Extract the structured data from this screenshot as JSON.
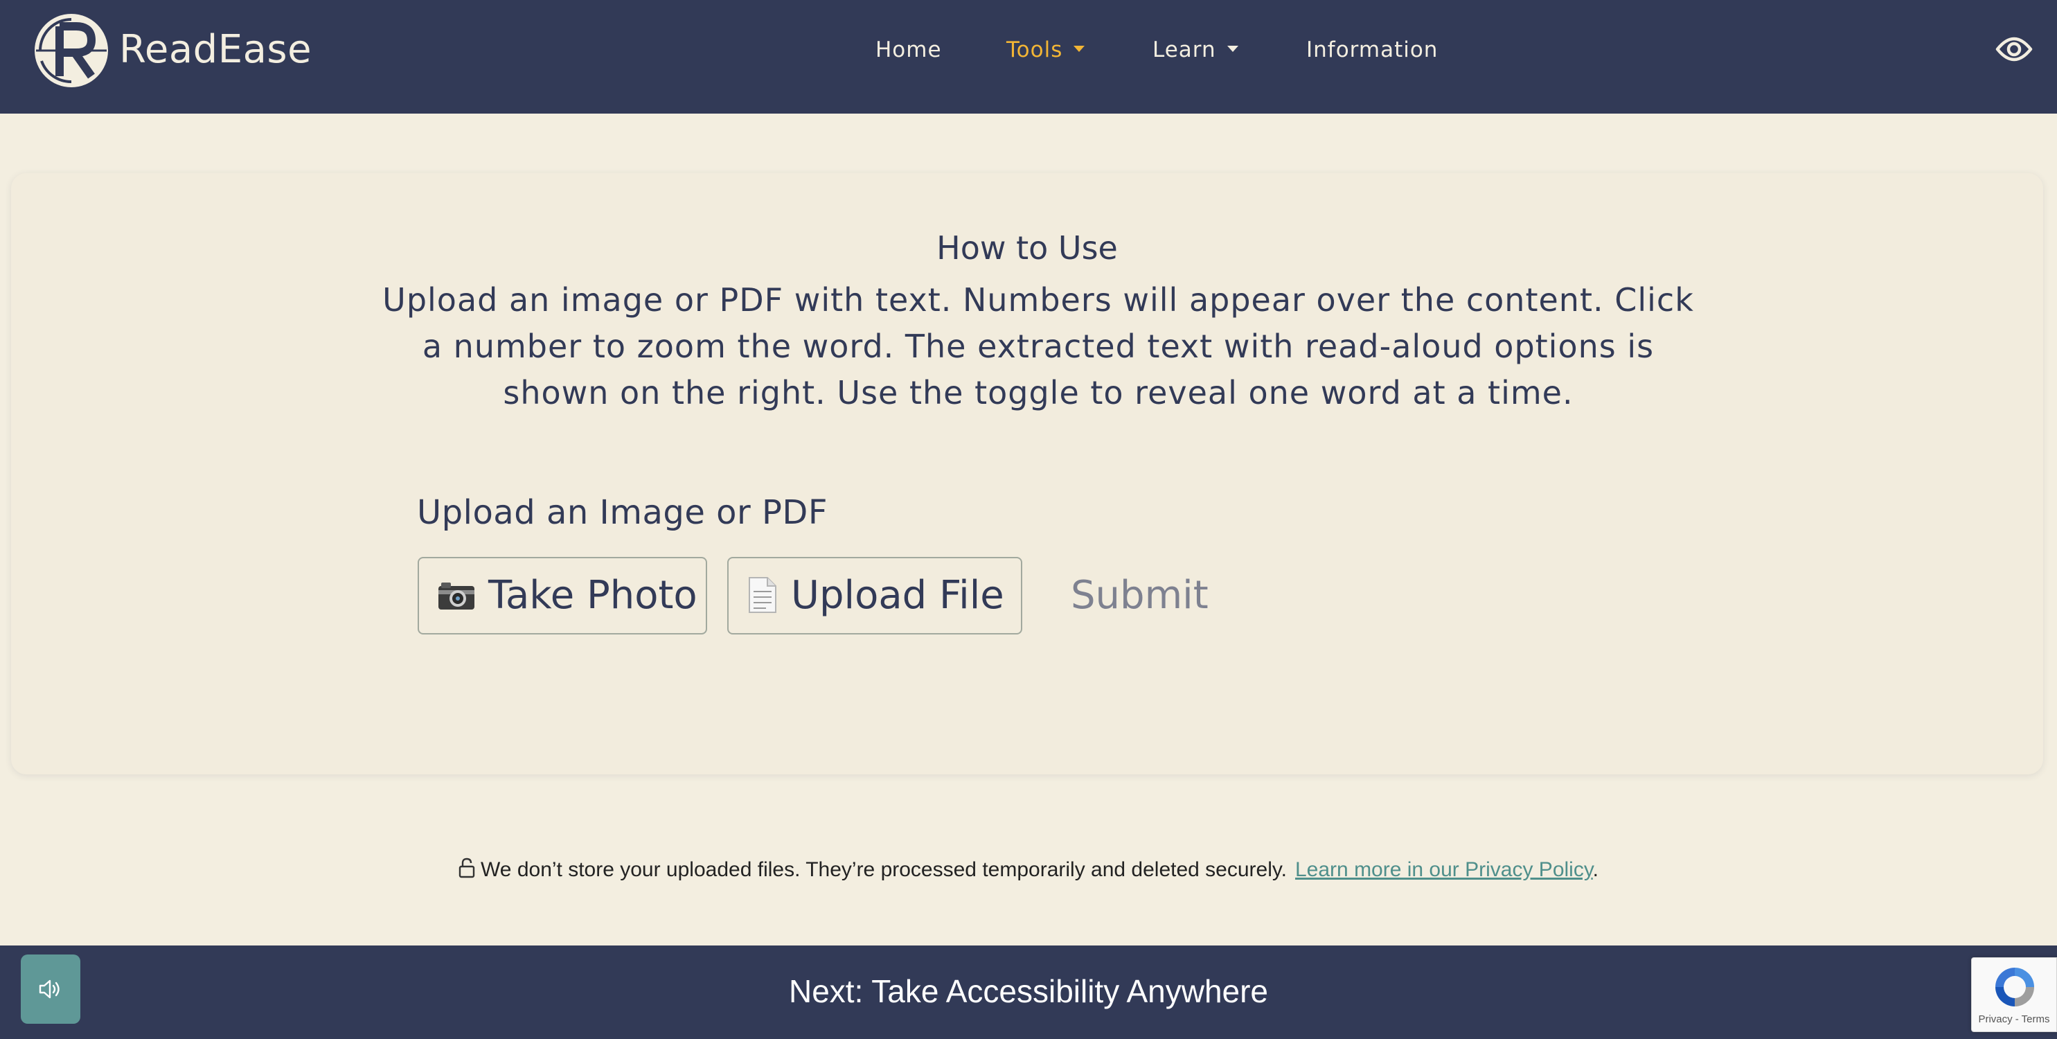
{
  "header": {
    "brand": "ReadEase",
    "nav": {
      "home": "Home",
      "tools": "Tools",
      "learn": "Learn",
      "information": "Information"
    },
    "active_color": "#f2b535",
    "background": "#323a57"
  },
  "card": {
    "title": "How to Use",
    "text": "Upload an image or PDF with text. Numbers will appear over the content. Click a number to zoom the word. The extracted text with read-aloud options is shown on the right. Use the toggle to reveal one word at a time.",
    "upload_label": "Upload an Image or PDF",
    "take_photo": "Take Photo",
    "upload_file": "Upload File",
    "submit": "Submit"
  },
  "privacy": {
    "text": "We don’t store your uploaded files. They’re processed temporarily and deleted securely.",
    "link": "Learn more in our Privacy Policy",
    "suffix": "."
  },
  "footer": {
    "title": "Next: Take Accessibility Anywhere"
  },
  "recaptcha": {
    "text": "Privacy - Terms"
  },
  "icons": {
    "logo": "readease-logo",
    "eye": "eye-icon",
    "camera": "camera-icon",
    "document": "document-icon",
    "lock": "lock-icon",
    "speaker": "speaker-icon",
    "recaptcha": "recaptcha-icon"
  }
}
